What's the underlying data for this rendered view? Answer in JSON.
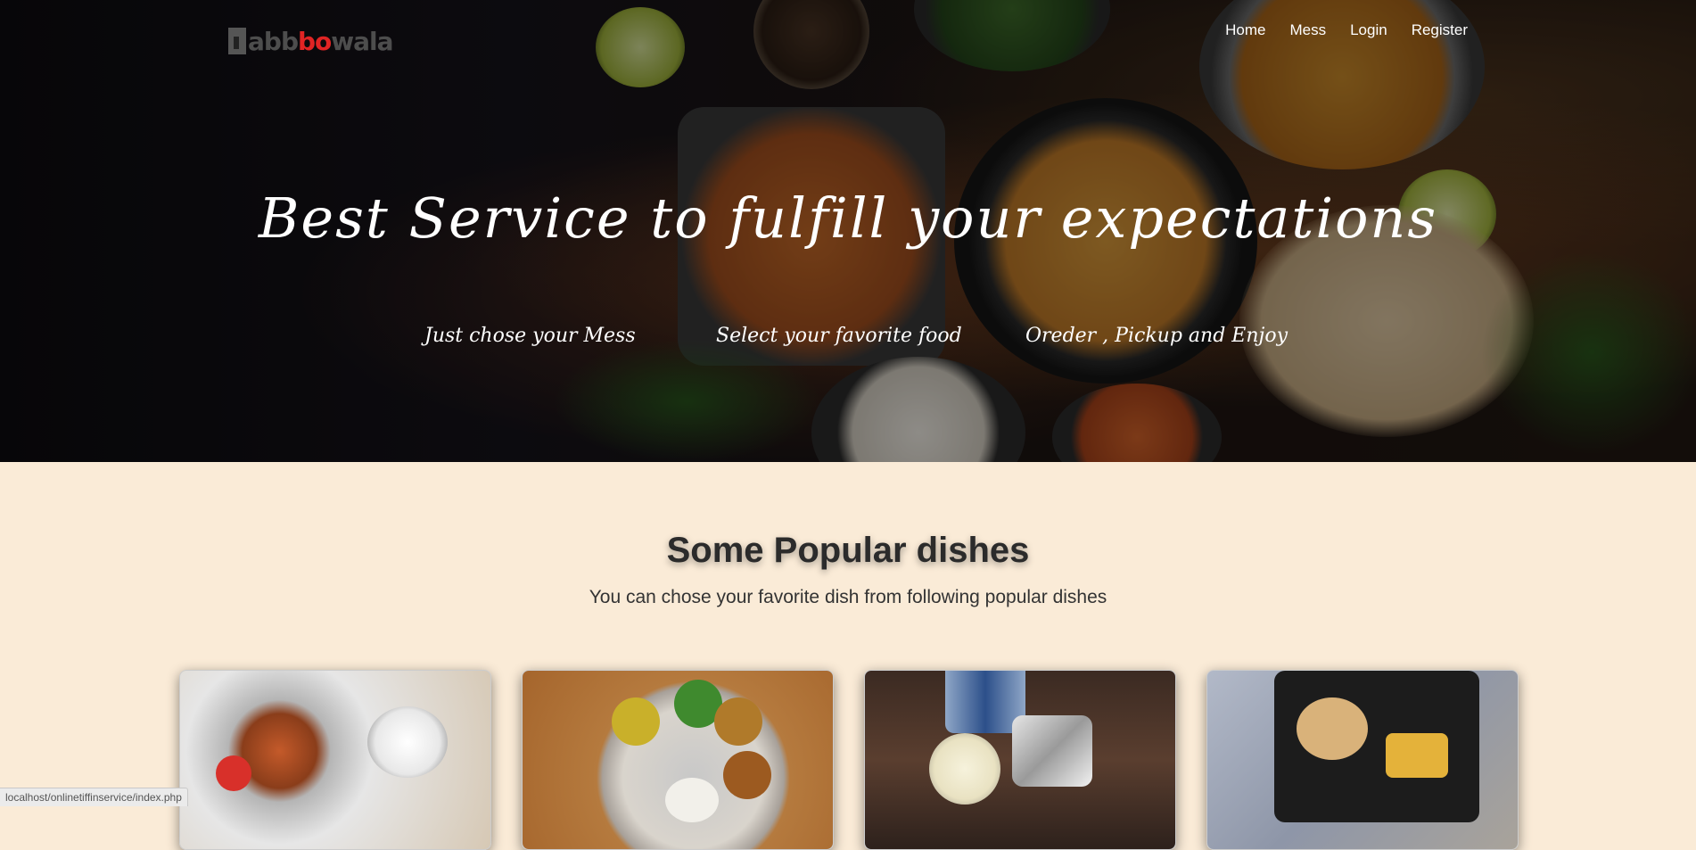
{
  "brand": {
    "logo_text_pre": "abb",
    "logo_text_red": "bo",
    "logo_text_post": "wala"
  },
  "nav": {
    "home": "Home",
    "mess": "Mess",
    "login": "Login",
    "register": "Register"
  },
  "hero": {
    "title": "Best Service to fulfill your expectations",
    "steps": [
      "Just chose your Mess",
      "Select your favorite food",
      "Oreder , Pickup and Enjoy"
    ]
  },
  "popular": {
    "title": "Some Popular dishes",
    "subtitle": "You can chose your favorite dish from following popular dishes"
  },
  "statusbar": {
    "url": "localhost/onlinetiffinservice/index.php"
  },
  "colors": {
    "page_bg": "#faebd7",
    "logo_accent": "#e02424",
    "nav_text": "#ffffff"
  }
}
